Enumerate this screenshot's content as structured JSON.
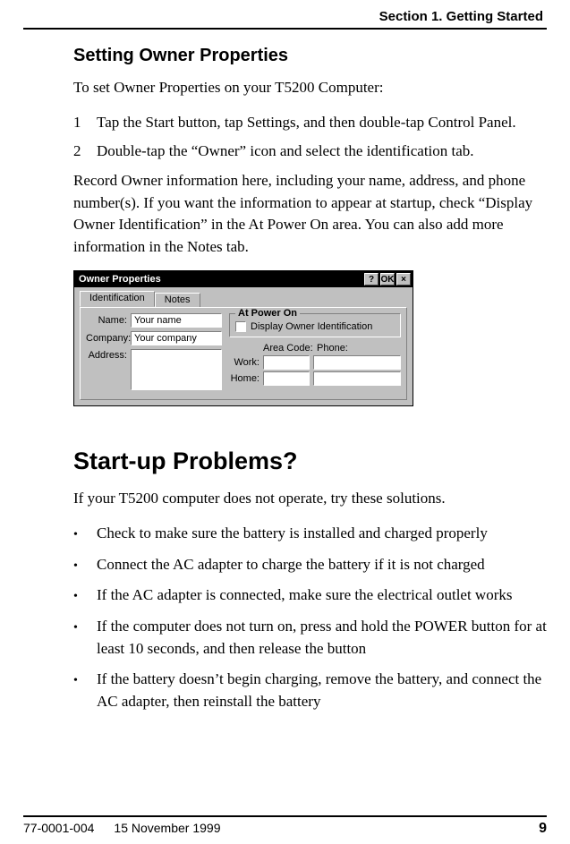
{
  "header": {
    "section": "Section 1. Getting Started"
  },
  "h2": "Setting Owner Properties",
  "intro": "To set Owner Properties on your T5200 Computer:",
  "steps": [
    "Tap the Start button, tap Settings, and then double-tap Control Panel.",
    "Double-tap the “Owner” icon and select the identification tab."
  ],
  "record_para": "Record Owner information here, including your name, address, and phone number(s).  If you want the information to appear at startup, check “Display Owner Identification” in the At Power On area.  You can also add more information in the Notes tab.",
  "window": {
    "title": "Owner Properties",
    "buttons": {
      "help": "?",
      "ok": "OK",
      "close": "×"
    },
    "tabs": {
      "identification": "Identification",
      "notes": "Notes"
    },
    "labels": {
      "name": "Name:",
      "company": "Company:",
      "address": "Address:",
      "work": "Work:",
      "home": "Home:",
      "area_code": "Area Code:",
      "phone": "Phone:"
    },
    "values": {
      "name": "Your name",
      "company": "Your company"
    },
    "group": {
      "legend": "At Power On",
      "checkbox_label": "Display Owner Identification"
    }
  },
  "h1": "Start-up Problems?",
  "problems_intro": "If your T5200 computer does not operate, try these solutions.",
  "bullets": [
    "Check to make sure the battery is installed and charged properly",
    "Connect the AC adapter to charge the battery if it is not charged",
    "If the AC adapter is connected, make sure the electrical outlet works",
    "If the computer does not turn on, press and hold the POWER button for at least 10 seconds, and then release the button",
    "If the battery doesn’t begin charging, remove the battery, and connect the AC adapter, then reinstall the battery"
  ],
  "footer": {
    "doc": "77-0001-004",
    "date": "15 November 1999",
    "page": "9"
  }
}
